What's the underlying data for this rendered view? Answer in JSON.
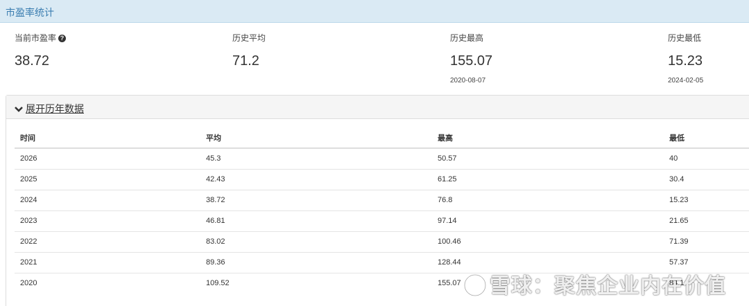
{
  "header": {
    "title": "市盈率统计"
  },
  "stats": [
    {
      "label": "当前市盈率",
      "value": "38.72",
      "date": "",
      "has_help": true
    },
    {
      "label": "历史平均",
      "value": "71.2",
      "date": ""
    },
    {
      "label": "历史最高",
      "value": "155.07",
      "date": "2020-08-07"
    },
    {
      "label": "历史最低",
      "value": "15.23",
      "date": "2024-02-05"
    }
  ],
  "panel": {
    "toggle_label": "展开历年数据",
    "toggle_icon": "chevron-down-icon"
  },
  "table": {
    "headers": [
      "时间",
      "平均",
      "最高",
      "最低"
    ],
    "rows": [
      [
        "2026",
        "45.3",
        "50.57",
        "40"
      ],
      [
        "2025",
        "42.43",
        "61.25",
        "30.4"
      ],
      [
        "2024",
        "38.72",
        "76.8",
        "15.23"
      ],
      [
        "2023",
        "46.81",
        "97.14",
        "21.65"
      ],
      [
        "2022",
        "83.02",
        "100.46",
        "71.39"
      ],
      [
        "2021",
        "89.36",
        "128.44",
        "57.37"
      ],
      [
        "2020",
        "109.52",
        "155.07",
        "84.14"
      ]
    ]
  },
  "watermark": {
    "text": "雪球：聚焦企业内在价值"
  }
}
